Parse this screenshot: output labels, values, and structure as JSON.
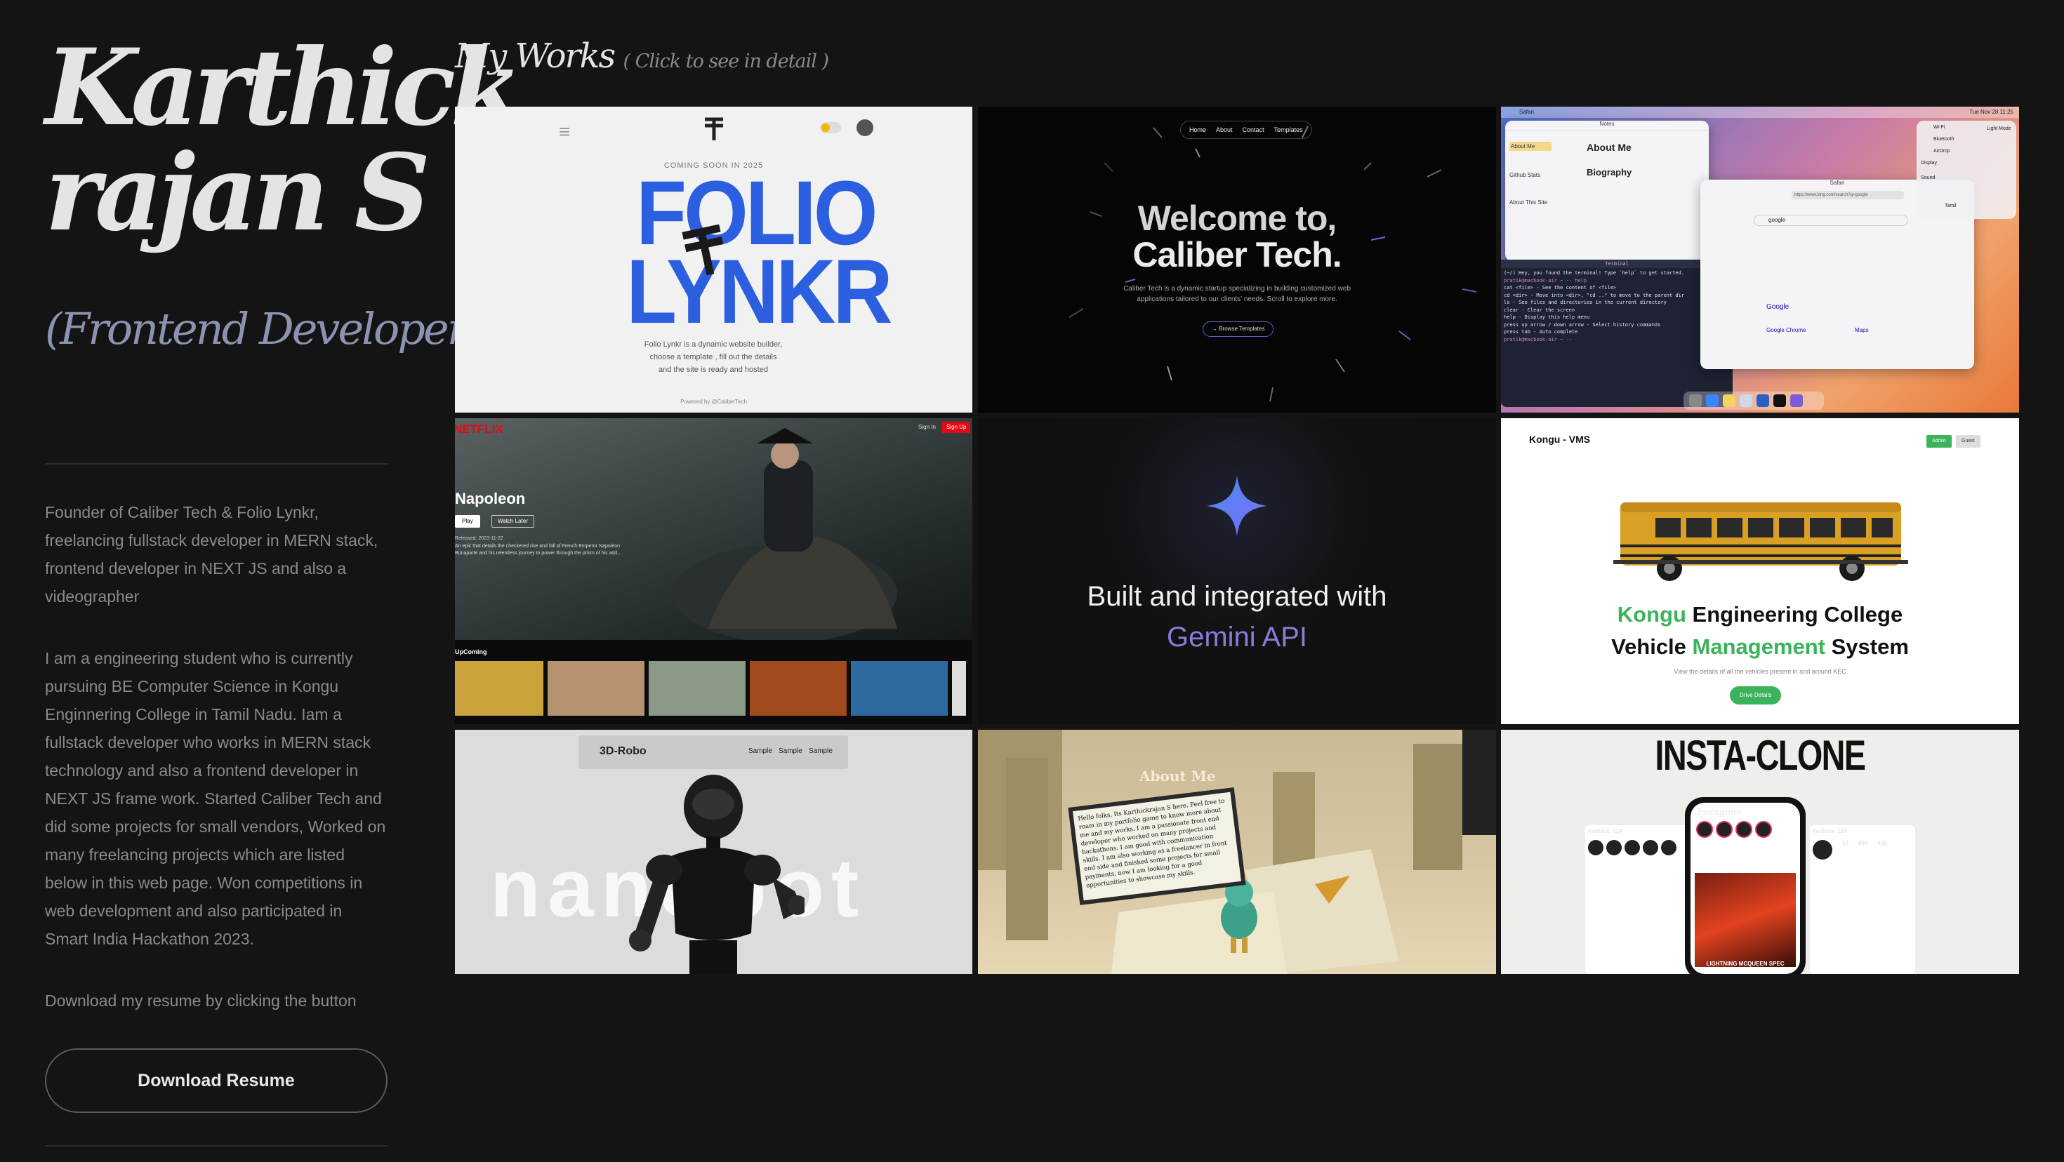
{
  "profile": {
    "name_line1": "Karthick",
    "name_line2": "rajan S -",
    "role": "(Frontend Developer)",
    "bio1": "Founder of Caliber Tech & Folio Lynkr, freelancing fullstack developer in MERN stack, frontend developer in NEXT JS and also a videographer",
    "bio2": "I am a engineering student who is currently pursuing BE Computer Science in Kongu Enginnering College in Tamil Nadu. Iam a fullstack developer who works in MERN stack technology and also a frontend developer in NEXT JS frame work. Started Caliber Tech and did some projects for small vendors, Worked on many freelancing projects which are listed below in this web page. Won competitions in web development and also participated in Smart India Hackathon 2023.",
    "resume_prompt": "Download my resume by clicking the button",
    "resume_button": "Download Resume"
  },
  "works": {
    "title": "My Works",
    "hint": "( Click to see in detail )",
    "folio": {
      "badge": "COMING SOON IN 2025",
      "logo_line1": "FOLIO",
      "logo_line2": "LYNKR",
      "desc": "Folio Lynkr is a dynamic website builder, choose a template , fill out the details and the site is ready and hosted",
      "footer": "Powered by  @CaliberTech"
    },
    "caliber": {
      "nav": [
        "Home",
        "About",
        "Contact",
        "Templates"
      ],
      "title_line1": "Welcome to,",
      "title_line2": "Caliber Tech.",
      "desc": "Caliber Tech is a dynamic startup specializing in building customized web applications tailored to our clients' needs. Scroll to explore more.",
      "cta": "→ Browse Templates"
    },
    "mac": {
      "menubar_app": "Safari",
      "clock": "Tue Nov 28 11:25",
      "notes_title": "Notes",
      "note1_title": "About Me",
      "note2_title": "Github Stats",
      "note3_title": "About This Site",
      "about_heading": "About Me",
      "bio_heading": "Biography",
      "terminal_title": "Terminal",
      "terminal_lines": [
        "(~/) Hey, you found the terminal! Type `help` to get started.",
        "pratik@macbook-air ~ -- help",
        "cat <file> - See the content of <file>",
        "cd <dir> - Move into <dir>, \"cd ..\" to move to the parent dir",
        "ls - See files and directories in the current directory",
        "clear - Clear the screen",
        "help - Display this help menu",
        "press up arrow / down arrow - Select history commands",
        "press tab - Auto complete",
        "pratik@macbook-air ~ --"
      ],
      "browser_title": "Safari",
      "browser_url": "https://www.bing.com/search?q=google",
      "search_query": "google",
      "result1": "Google",
      "result2": "Google Chrome",
      "result3": "Maps",
      "cc_wifi": "Wi-Fi",
      "cc_bt": "Bluetooth",
      "cc_airdrop": "AirDrop",
      "cc_display": "Display",
      "cc_sound": "Sound",
      "cc_light": "Light Mode",
      "cc_track": "Tamil"
    },
    "netflix": {
      "brand": "NETFLIX",
      "signin": "Sign In",
      "signup": "Sign Up",
      "movie": "Napoleon",
      "play": "Play",
      "watch_later": "Watch Later",
      "released": "Released: 2023-11-22",
      "desc": "An epic that details the checkered rise and fall of French Emperor Napoleon Bonaparte and his relentless journey to power through the prism of his add...",
      "upcoming": "UpComing"
    },
    "gemini": {
      "line1": "Built and integrated with",
      "line2": "Gemini API"
    },
    "kongu": {
      "brand": "Kongu - VMS",
      "btn_admin": "Admin",
      "btn_guest": "Guest",
      "title_w1": "Kongu",
      "title_w2": " Engineering College",
      "title_w3": "Vehicle ",
      "title_w4": "Management",
      "title_w5": " System",
      "desc": "View the details of all the vehicles present in and around KEC",
      "cta": "Drive Details"
    },
    "robo": {
      "brand": "3D-Robo",
      "links": [
        "Sample",
        "Sample",
        "Sample"
      ],
      "bg_word": "nanobot"
    },
    "about": {
      "heading": "About Me",
      "text": "Hello folks, Its Karthickrajan S here. Feel free to roam in my portfolio game to know more about me and my works. I am a passionate front end developer who worked on many projects and hackathons. I am good with communication skills. I am also working as a freelancer in front end side and finished some projects for small payments, now I am looking for a good opportunities to showcase my skills."
    },
    "insta": {
      "title": "INSTA-CLONE",
      "logo": "Instagram",
      "user": "karthick_124_",
      "stats": [
        "10",
        "856",
        "435"
      ],
      "car_caption": "LIGHTNING MCQUEEN SPEC"
    }
  },
  "colors": {
    "background": "#141414",
    "accent_blue": "#2c5ee0",
    "netflix_red": "#e50914",
    "kongu_green": "#3bb35a"
  }
}
